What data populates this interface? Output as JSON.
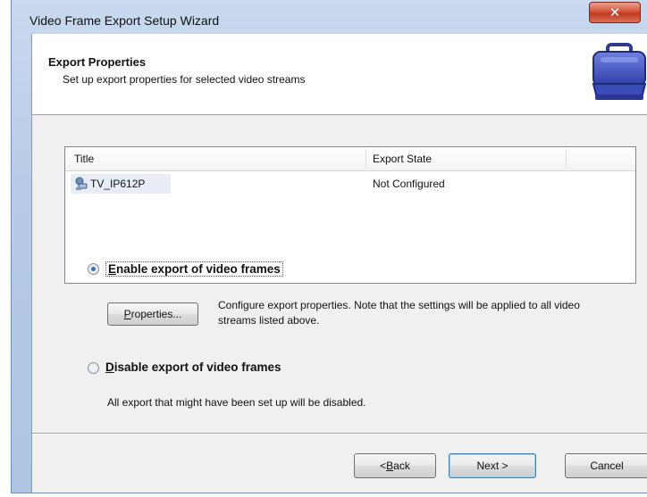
{
  "window": {
    "title": "Video Frame Export Setup Wizard",
    "close_glyph": "✕"
  },
  "header": {
    "title": "Export Properties",
    "subtitle": "Set up export properties for selected video streams",
    "icon": "case-icon"
  },
  "list": {
    "columns": [
      "Title",
      "Export State"
    ],
    "rows": [
      {
        "icon": "camera-icon",
        "title": "TV_IP612P",
        "state": "Not Configured"
      }
    ]
  },
  "options": {
    "enable": {
      "mnemonic": "E",
      "rest": "nable export of video frames",
      "selected": true
    },
    "properties_button": {
      "mnemonic": "P",
      "rest": "roperties..."
    },
    "properties_desc": "Configure export properties. Note that the settings will be applied to all video streams listed above.",
    "disable": {
      "mnemonic": "D",
      "rest": "isable export of video frames",
      "selected": false
    },
    "disable_desc": "All export that might have been set up will be disabled."
  },
  "footer": {
    "back": {
      "prefix": "< ",
      "mnemonic": "B",
      "rest": "ack"
    },
    "next": "Next >",
    "cancel": "Cancel"
  },
  "colors": {
    "accent": "#3a6fb3",
    "close_button": "#c13a20",
    "case_icon": "#4a5bc4"
  }
}
